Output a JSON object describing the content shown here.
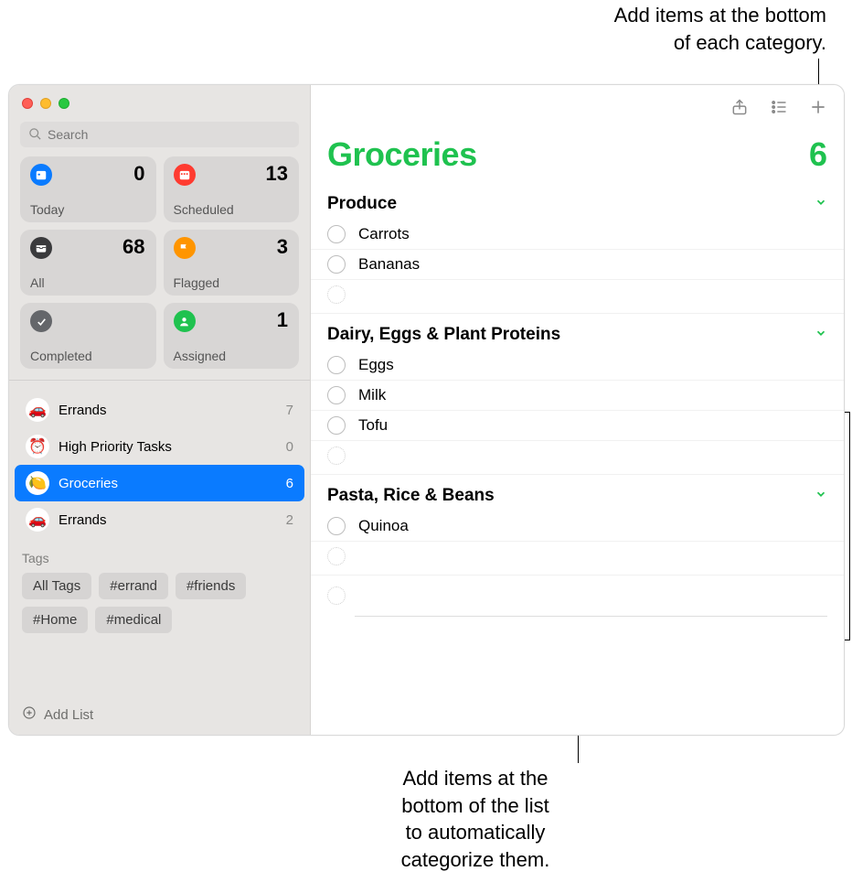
{
  "callouts": {
    "top": "Add items at the bottom\nof each category.",
    "bottom": "Add items at the\nbottom of the list\nto automatically\ncategorize them."
  },
  "sidebar": {
    "search_placeholder": "Search",
    "cards": [
      {
        "label": "Today",
        "count": "0",
        "color": "#0a7bff",
        "icon": "calendar"
      },
      {
        "label": "Scheduled",
        "count": "13",
        "color": "#ff3b30",
        "icon": "calendar-grid"
      },
      {
        "label": "All",
        "count": "68",
        "color": "#3a3a3c",
        "icon": "tray"
      },
      {
        "label": "Flagged",
        "count": "3",
        "color": "#ff9500",
        "icon": "flag"
      },
      {
        "label": "Completed",
        "count": "",
        "color": "#64666a",
        "icon": "check"
      },
      {
        "label": "Assigned",
        "count": "1",
        "color": "#1fc24f",
        "icon": "person"
      }
    ],
    "lists": [
      {
        "name": "Errands",
        "count": "7",
        "emoji": "🚗"
      },
      {
        "name": "High Priority Tasks",
        "count": "0",
        "emoji": "⏰"
      },
      {
        "name": "Groceries",
        "count": "6",
        "emoji": "🍋"
      },
      {
        "name": "Errands",
        "count": "2",
        "emoji": "🚗"
      }
    ],
    "tags_header": "Tags",
    "tags": [
      "All Tags",
      "#errand",
      "#friends",
      "#Home",
      "#medical"
    ],
    "add_list_label": "Add List"
  },
  "main": {
    "title": "Groceries",
    "count": "6",
    "sections": [
      {
        "header": "Produce",
        "items": [
          "Carrots",
          "Bananas"
        ]
      },
      {
        "header": "Dairy, Eggs & Plant Proteins",
        "items": [
          "Eggs",
          "Milk",
          "Tofu"
        ]
      },
      {
        "header": "Pasta, Rice & Beans",
        "items": [
          "Quinoa"
        ]
      }
    ]
  }
}
